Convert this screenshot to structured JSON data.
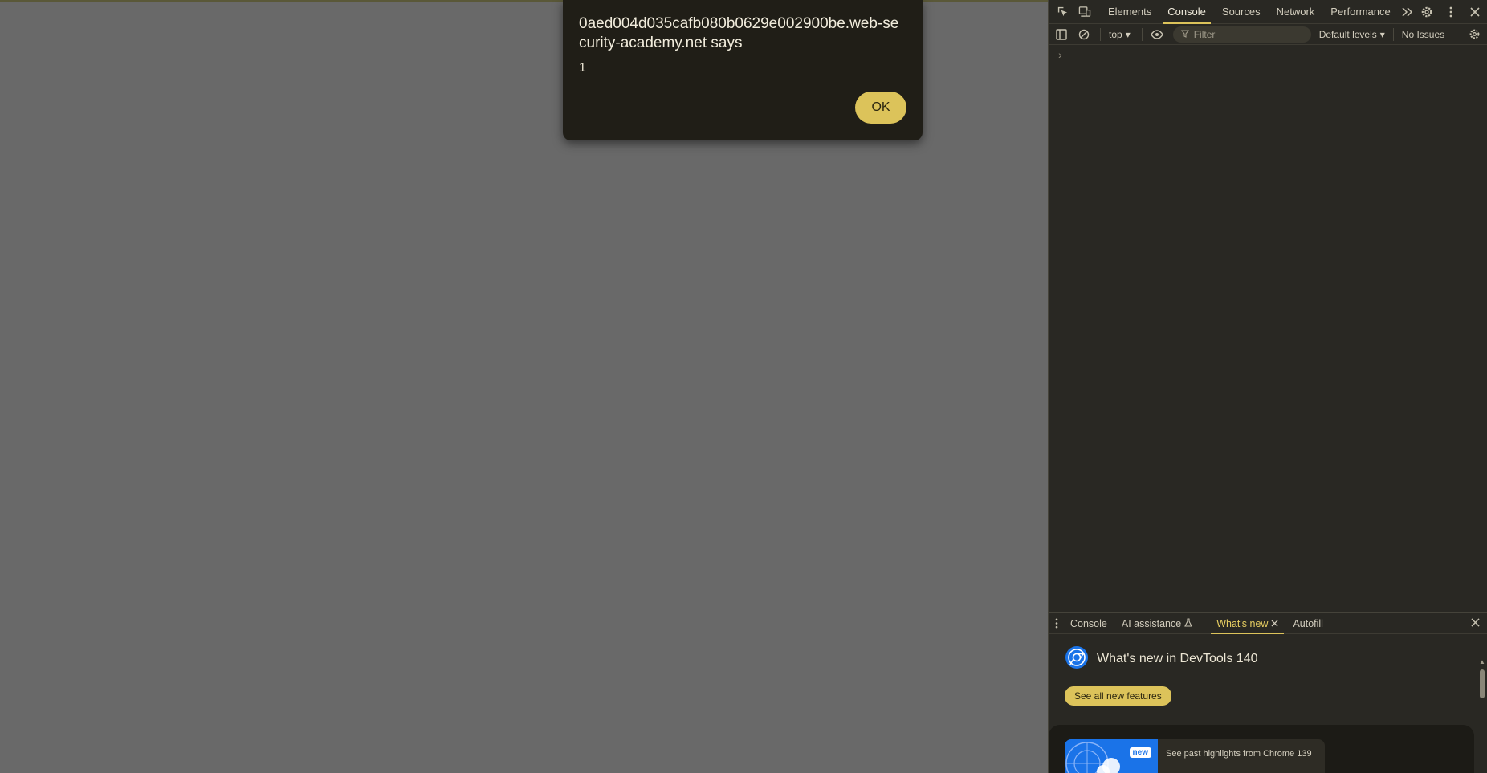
{
  "alert": {
    "origin": "0aed004d035cafb080b0629e002900be.web-security-academy.net says",
    "message": "1",
    "ok_label": "OK"
  },
  "devtools": {
    "tabs": [
      {
        "label": "Elements"
      },
      {
        "label": "Console"
      },
      {
        "label": "Sources"
      },
      {
        "label": "Network"
      },
      {
        "label": "Performance"
      }
    ],
    "console_toolbar": {
      "context": "top",
      "filter_placeholder": "Filter",
      "levels": "Default levels",
      "issues": "No Issues"
    },
    "prompt": "›",
    "drawer": {
      "tabs": [
        {
          "label": "Console"
        },
        {
          "label": "AI assistance"
        },
        {
          "label": "What's new"
        },
        {
          "label": "Autofill"
        }
      ],
      "whats_new": {
        "title": "What's new in DevTools 140",
        "button": "See all new features",
        "badge": "new",
        "card_text": "See past highlights from Chrome 139"
      }
    }
  }
}
